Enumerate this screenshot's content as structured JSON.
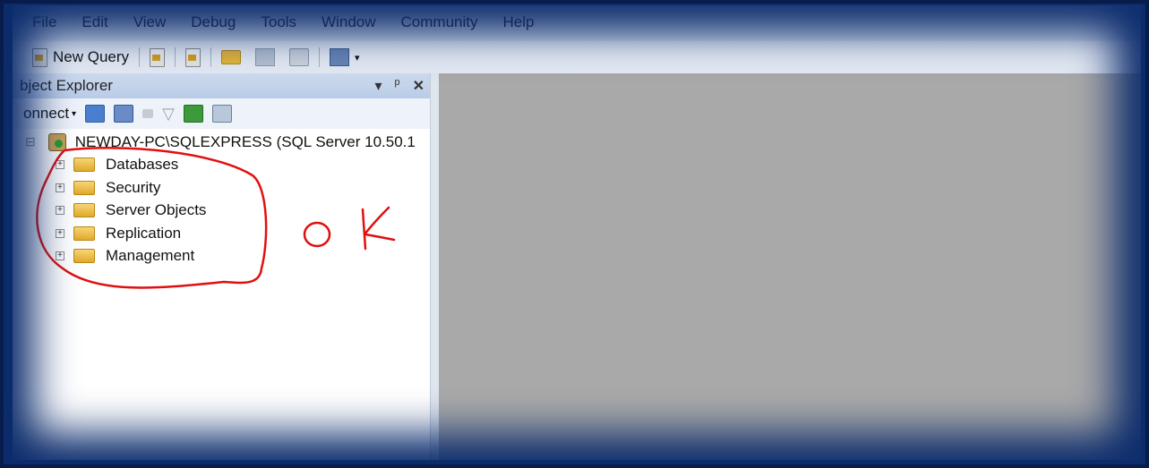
{
  "menu": [
    "File",
    "Edit",
    "View",
    "Debug",
    "Tools",
    "Window",
    "Community",
    "Help"
  ],
  "toolbar": {
    "new_query_label": "New Query",
    "icons": [
      "new-query-icon",
      "new-file-icon",
      "new-project-icon",
      "open-folder-icon",
      "save-icon",
      "print-icon",
      "activity-monitor-icon"
    ]
  },
  "explorer": {
    "title": "bject Explorer",
    "title_controls": [
      "▾",
      "ᵖ",
      "✕"
    ],
    "connect_label": "onnect",
    "server": {
      "label": "NEWDAY-PC\\SQLEXPRESS (SQL Server 10.50.1",
      "expander": "⊟"
    },
    "nodes": [
      "Databases",
      "Security",
      "Server Objects",
      "Replication",
      "Management"
    ]
  },
  "annotation": {
    "text": "OK",
    "color": "#e01010"
  },
  "colors": {
    "frame": "#0b2a68",
    "document_area": "#a9a9a9",
    "title_bar": "#b8cbe6"
  }
}
